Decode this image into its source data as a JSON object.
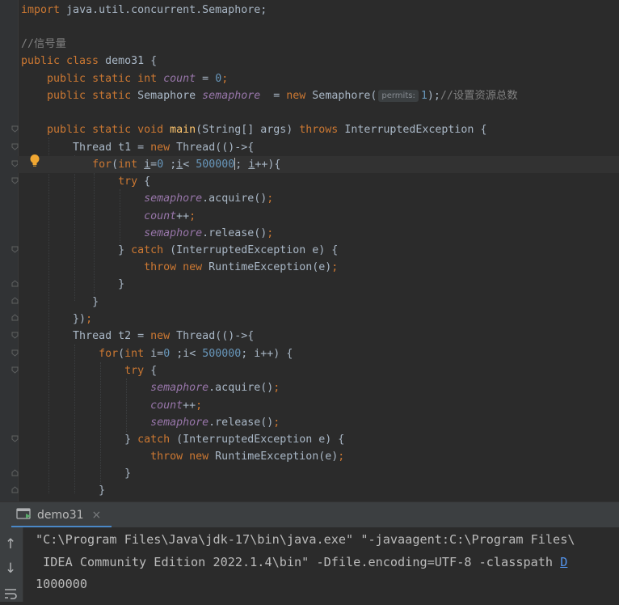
{
  "editor": {
    "line_import": {
      "kw": "import",
      "rest": " java.util.concurrent.Semaphore;"
    },
    "comment_semaphore": "//信号量",
    "class_decl": {
      "kw": "public class",
      "name": " demo31 {"
    },
    "field_count": {
      "kw1": "public static int",
      "name": "count",
      "op": " = ",
      "num": "0",
      "semi": ";"
    },
    "field_sem": {
      "kw": "public static",
      "type": " Semaphore ",
      "name": "semaphore",
      "op": "  = ",
      "new_kw": "new",
      "ctor": " Semaphore(",
      "hint": "permits:",
      "num": "1",
      "close": ");",
      "comment": "//设置资源总数"
    },
    "main_decl": {
      "kw": "public static void",
      "name": "main",
      "args": "(String[] args) ",
      "throws_kw": "throws",
      "ex": " InterruptedException {"
    },
    "t1_decl": {
      "pre": "Thread t1 = ",
      "new_kw": "new",
      "post": " Thread(()->{"
    },
    "t2_decl": {
      "pre": "Thread t2 = ",
      "new_kw": "new",
      "post": " Thread(()->{"
    },
    "for_t1": {
      "kw1": "for",
      "p1": "(",
      "kw2": "int",
      "i1": "i",
      "p2": "=",
      "n0": "0",
      "p3": " ;",
      "i2": "i",
      "p4": "< ",
      "nmax": "500000",
      "p5": "; ",
      "i3": "i",
      "p6": "++){"
    },
    "for_t2": {
      "kw1": "for",
      "p1": "(",
      "kw2": "int",
      "rest1": " i=",
      "n0": "0",
      "rest2": " ;i< ",
      "nmax": "500000",
      "rest3": "; i++) {"
    },
    "try_kw": "try",
    "brace_open": " {",
    "acquire": {
      "field": "semaphore",
      "call": ".acquire()",
      "semi": ";"
    },
    "count_inc": {
      "field": "count",
      "op": "++",
      "semi": ";"
    },
    "release": {
      "field": "semaphore",
      "call": ".release()",
      "semi": ";"
    },
    "catch_line": {
      "pre": "} ",
      "kw": "catch",
      "post": " (InterruptedException e) {"
    },
    "throw_line": {
      "kw1": "throw",
      "kw2": " new",
      "post": " RuntimeException(e)",
      "semi": ";"
    },
    "close_brace": "}",
    "close_lambda": {
      "pre": "})",
      "semi": ";"
    }
  },
  "run_tab": {
    "label": "demo31",
    "close": "×"
  },
  "console": {
    "line1": "\"C:\\Program Files\\Java\\jdk-17\\bin\\java.exe\" \"-javaagent:C:\\Program Files\\",
    "line2_text": " IDEA Community Edition 2022.1.4\\bin\" -Dfile.encoding=UTF-8 -classpath ",
    "line2_link": "D",
    "line3": "1000000"
  },
  "tools": {
    "up": "↑",
    "down": "↓"
  },
  "colors": {
    "keyword": "#cc7832",
    "field": "#9876aa",
    "number": "#6897bb",
    "method": "#ffc66d",
    "comment": "#808080",
    "text": "#a9b7c6",
    "link": "#5394ec",
    "tab_accent": "#4a88c7"
  }
}
